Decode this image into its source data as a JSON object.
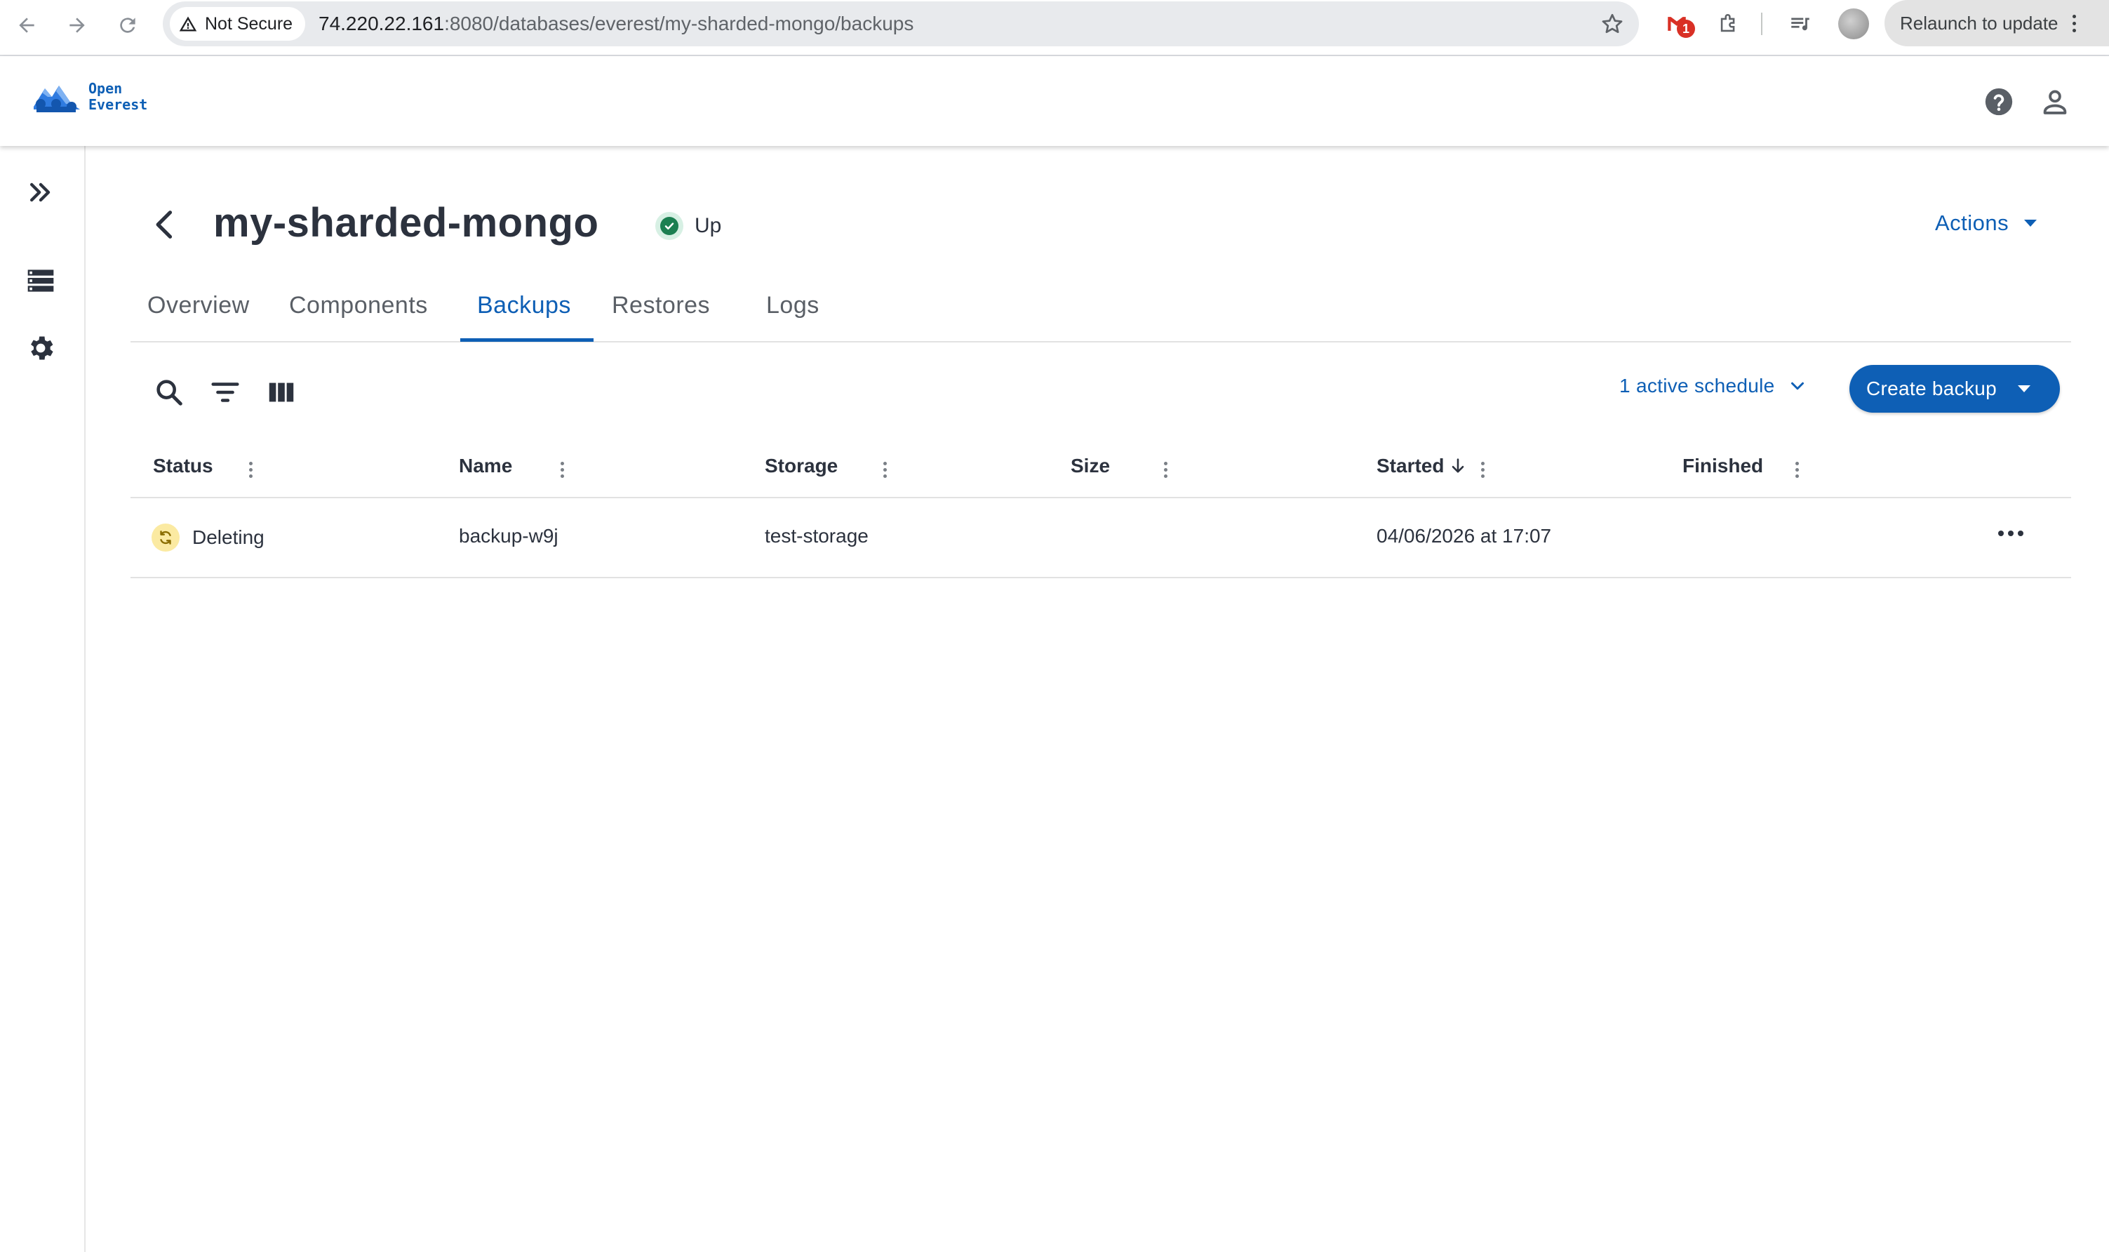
{
  "browser": {
    "security_label": "Not Secure",
    "url_host": "74.220.22.161",
    "url_rest": ":8080/databases/everest/my-sharded-mongo/backups",
    "gmail_badge": "1",
    "relaunch_label": "Relaunch to update"
  },
  "app": {
    "logo_line1": "Open",
    "logo_line2": "Everest",
    "brand_color": "#0e5fb5"
  },
  "sidebar": {
    "items": [
      {
        "icon": "expand-icon"
      },
      {
        "icon": "databases-icon"
      },
      {
        "icon": "settings-icon"
      }
    ]
  },
  "page": {
    "title": "my-sharded-mongo",
    "status": "Up",
    "actions_label": "Actions"
  },
  "tabs": [
    {
      "label": "Overview",
      "active": false
    },
    {
      "label": "Components",
      "active": false
    },
    {
      "label": "Backups",
      "active": true
    },
    {
      "label": "Restores",
      "active": false
    },
    {
      "label": "Logs",
      "active": false
    }
  ],
  "toolbar": {
    "schedule_label": "1 active schedule",
    "create_label": "Create backup"
  },
  "table": {
    "columns": [
      "Status",
      "Name",
      "Storage",
      "Size",
      "Started",
      "Finished"
    ],
    "sorted_column": "Started",
    "sort_direction": "descending",
    "rows": [
      {
        "status": "Deleting",
        "name": "backup-w9j",
        "storage": "test-storage",
        "size": "",
        "started": "04/06/2026 at 17:07",
        "finished": ""
      }
    ]
  }
}
